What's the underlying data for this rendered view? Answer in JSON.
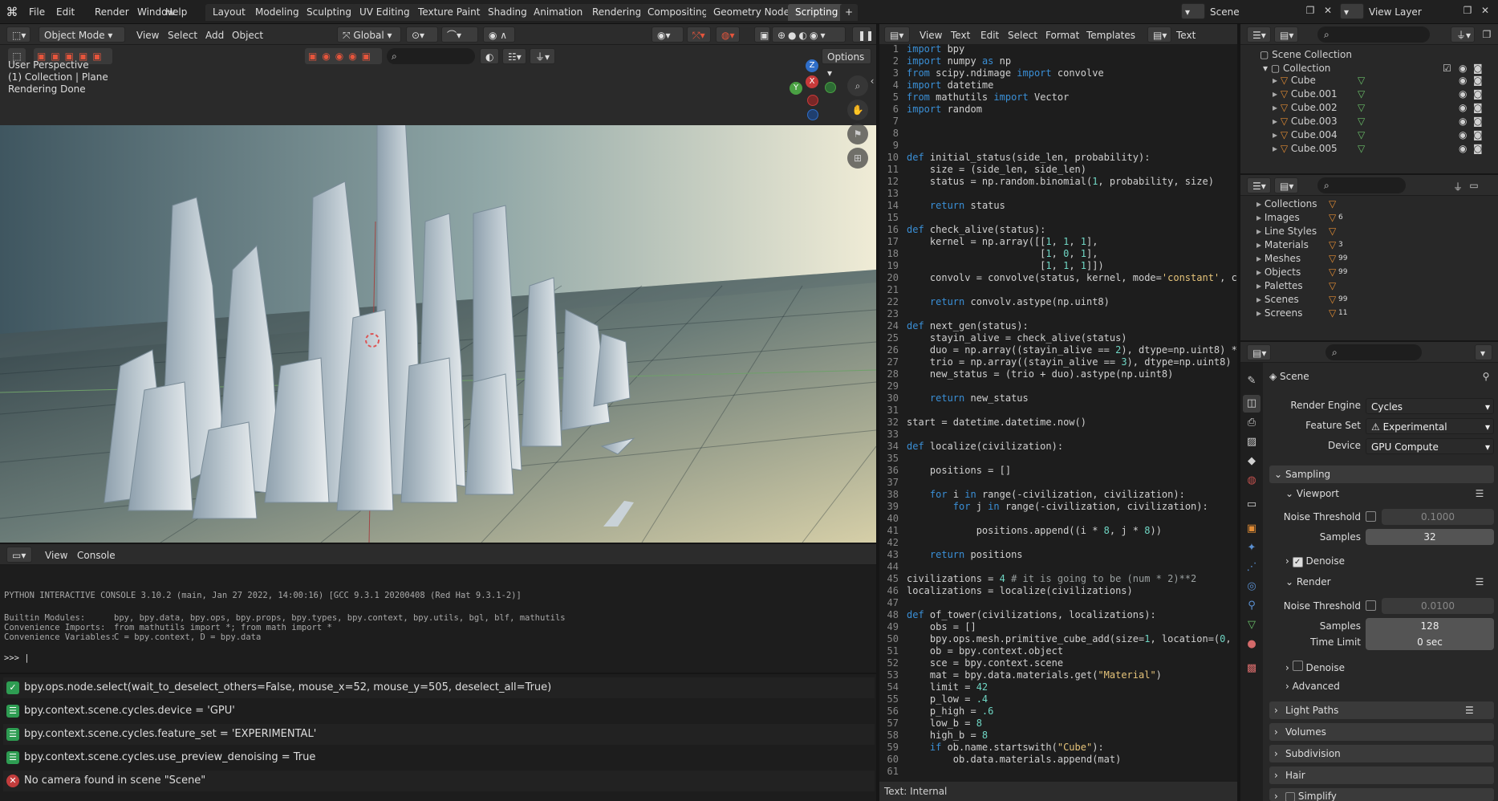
{
  "topbar": {
    "menus": [
      "File",
      "Edit",
      "Render",
      "Window",
      "Help"
    ],
    "workspaces": [
      "Layout",
      "Modeling",
      "Sculpting",
      "UV Editing",
      "Texture Paint",
      "Shading",
      "Animation",
      "Rendering",
      "Compositing",
      "Geometry Nodes",
      "Scripting"
    ],
    "active": "Scripting",
    "add_tab": "+",
    "scene": "Scene",
    "view_layer": "View Layer"
  },
  "viewport": {
    "mode": "Object Mode",
    "menus": [
      "View",
      "Select",
      "Add",
      "Object"
    ],
    "orientation": "Global",
    "options": "Options",
    "info": [
      "User Perspective",
      "(1) Collection | Plane",
      "Rendering Done"
    ],
    "gizmo": {
      "z": "Z",
      "y": "Y",
      "x": "X"
    }
  },
  "console": {
    "menus": [
      "View",
      "Console"
    ],
    "banner": "PYTHON INTERACTIVE CONSOLE 3.10.2 (main, Jan 27 2022, 14:00:16) [GCC 9.3.1 20200408 (Red Hat 9.3.1-2)]",
    "lines": [
      {
        "k": "Builtin Modules:",
        "v": "bpy, bpy.data, bpy.ops, bpy.props, bpy.types, bpy.context, bpy.utils, bgl, blf, mathutils"
      },
      {
        "k": "Convenience Imports:",
        "v": "from mathutils import *; from math import *"
      },
      {
        "k": "Convenience Variables:",
        "v": "C = bpy.context, D = bpy.data"
      }
    ],
    "prompt": ">>> "
  },
  "info_log": [
    {
      "type": "ok",
      "text": "bpy.ops.node.select(wait_to_deselect_others=False, mouse_x=52, mouse_y=505, deselect_all=True)"
    },
    {
      "type": "op",
      "text": "bpy.context.scene.cycles.device = 'GPU'"
    },
    {
      "type": "op",
      "text": "bpy.context.scene.cycles.feature_set = 'EXPERIMENTAL'"
    },
    {
      "type": "op",
      "text": "bpy.context.scene.cycles.use_preview_denoising = True"
    },
    {
      "type": "err",
      "text": "No camera found in scene \"Scene\""
    }
  ],
  "text_editor": {
    "menus": [
      "View",
      "Text",
      "Edit",
      "Select",
      "Format",
      "Templates"
    ],
    "text_name": "Text",
    "footer": "Text: Internal"
  },
  "code": [
    "import bpy",
    "import numpy as np",
    "from scipy.ndimage import convolve",
    "import datetime",
    "from mathutils import Vector",
    "import random",
    "",
    "",
    "",
    "def initial_status(side_len, probability):",
    "    size = (side_len, side_len)",
    "    status = np.random.binomial(1, probability, size)",
    "",
    "    return status",
    "",
    "def check_alive(status):",
    "    kernel = np.array([[1, 1, 1],",
    "                       [1, 0, 1],",
    "                       [1, 1, 1]])",
    "    convolv = convolve(status, kernel, mode='constant', c",
    "",
    "    return convolv.astype(np.uint8)",
    "",
    "def next_gen(status):",
    "    stayin_alive = check_alive(status)",
    "    duo = np.array((stayin_alive == 2), dtype=np.uint8) *",
    "    trio = np.array((stayin_alive == 3), dtype=np.uint8)",
    "    new_status = (trio + duo).astype(np.uint8)",
    "",
    "    return new_status",
    "",
    "start = datetime.datetime.now()",
    "",
    "def localize(civilization):",
    "",
    "    positions = []",
    "",
    "    for i in range(-civilization, civilization):",
    "        for j in range(-civilization, civilization):",
    "",
    "            positions.append((i * 8, j * 8))",
    "",
    "    return positions",
    "",
    "civilizations = 4 # it is going to be (num * 2)**2",
    "localizations = localize(civilizations)",
    "",
    "def of_tower(civilizations, localizations):",
    "    obs = []",
    "    bpy.ops.mesh.primitive_cube_add(size=1, location=(0,",
    "    ob = bpy.context.object",
    "    sce = bpy.context.scene",
    "    mat = bpy.data.materials.get(\"Material\")",
    "    limit = 42",
    "    p_low = .4",
    "    p_high = .6",
    "    low_b = 8",
    "    high_b = 8",
    "    if ob.name.startswith(\"Cube\"):",
    "        ob.data.materials.append(mat)",
    ""
  ],
  "outliner": {
    "root": "Scene Collection",
    "collection": "Collection",
    "objects": [
      "Cube",
      "Cube.001",
      "Cube.002",
      "Cube.003",
      "Cube.004",
      "Cube.005"
    ]
  },
  "blend_data": [
    {
      "label": "Collections",
      "badge": ""
    },
    {
      "label": "Images",
      "badge": "6"
    },
    {
      "label": "Line Styles",
      "badge": ""
    },
    {
      "label": "Materials",
      "badge": "3"
    },
    {
      "label": "Meshes",
      "badge": "99"
    },
    {
      "label": "Objects",
      "badge": "99"
    },
    {
      "label": "Palettes",
      "badge": ""
    },
    {
      "label": "Scenes",
      "badge": "99"
    },
    {
      "label": "Screens",
      "badge": "11"
    }
  ],
  "properties": {
    "title": "Scene",
    "render_engine_label": "Render Engine",
    "render_engine": "Cycles",
    "feature_set_label": "Feature Set",
    "feature_set": "Experimental",
    "device_label": "Device",
    "device": "GPU Compute",
    "sampling": "Sampling",
    "viewport": "Viewport",
    "noise_threshold_label": "Noise Threshold",
    "viewport_noise": "0.1000",
    "samples_label": "Samples",
    "viewport_samples": "32",
    "denoise": "Denoise",
    "render": "Render",
    "render_noise": "0.0100",
    "render_samples": "128",
    "time_limit_label": "Time Limit",
    "time_limit": "0 sec",
    "advanced": "Advanced",
    "light_paths": "Light Paths",
    "volumes": "Volumes",
    "subdivision": "Subdivision",
    "hair": "Hair",
    "simplify": "Simplify"
  },
  "colors": {
    "accent": "#4772b3",
    "active_tab": "#4a4a4a",
    "ok": "#2e9c52",
    "op": "#2e9c52",
    "err": "#c23c3c"
  }
}
